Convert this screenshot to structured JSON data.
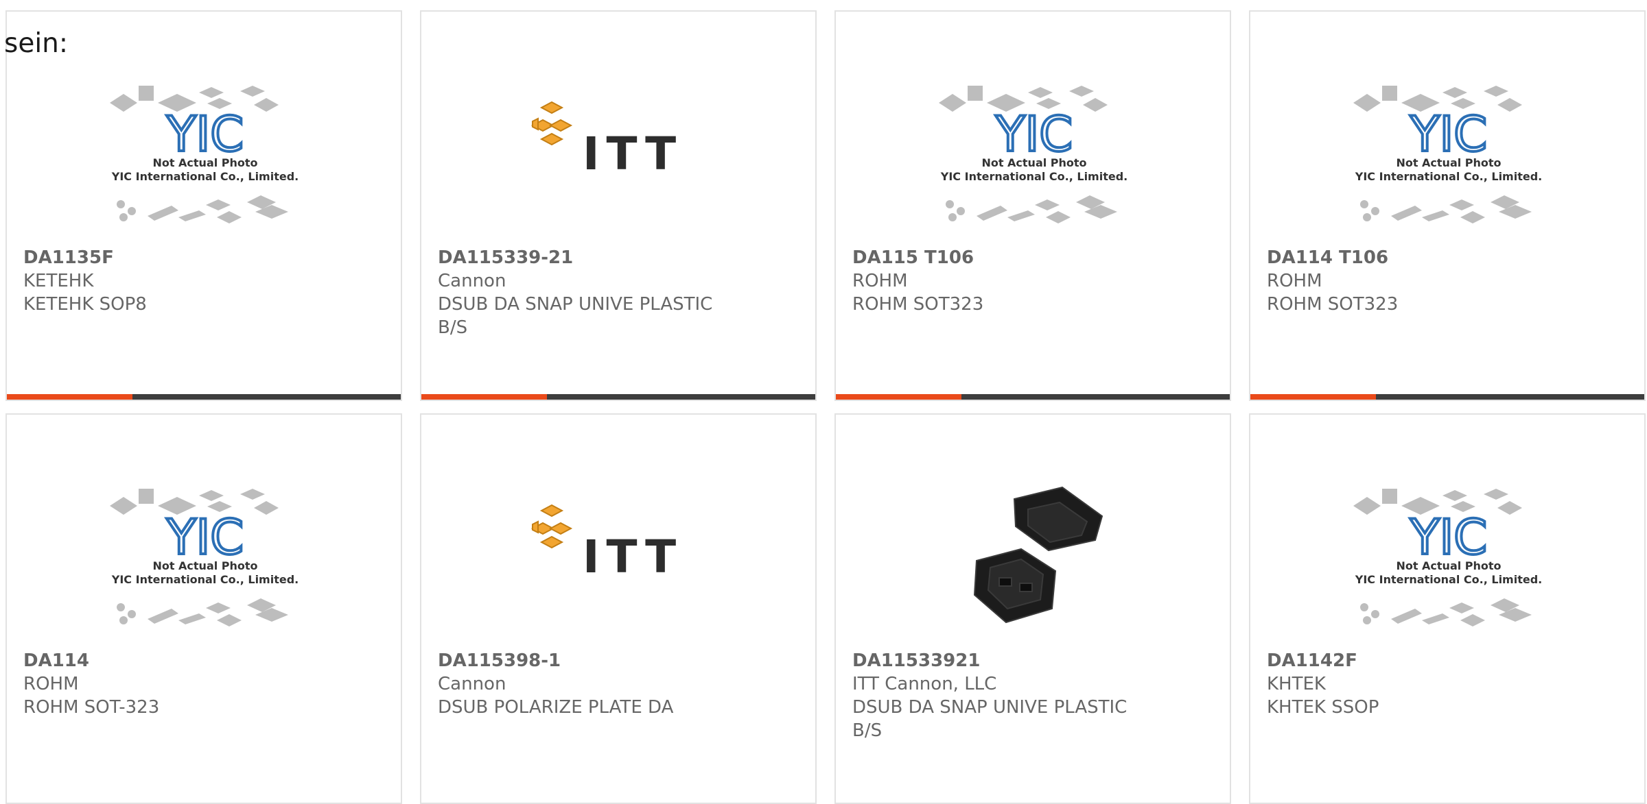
{
  "lead_text": "sein:",
  "colors": {
    "accent": "#ea4a1a",
    "bar_dark": "#3e3e3e",
    "yic_blue": "#2b6fb5",
    "itt_orange": "#f2a531"
  },
  "products": [
    {
      "part_number": "DA1135F",
      "manufacturer": "KETEHK",
      "description": "KETEHK SOP8",
      "image": "yic-placeholder",
      "image_caption": "Not Actual Photo",
      "image_caption2": "YIC International Co., Limited."
    },
    {
      "part_number": "DA115339-21",
      "manufacturer": "Cannon",
      "description": "DSUB DA SNAP UNIVE PLASTIC B/S",
      "image": "itt-logo",
      "logo_text": "ITT"
    },
    {
      "part_number": "DA115 T106",
      "manufacturer": "ROHM",
      "description": "ROHM SOT323",
      "image": "yic-placeholder",
      "image_caption": "Not Actual Photo",
      "image_caption2": "YIC International Co., Limited."
    },
    {
      "part_number": "DA114 T106",
      "manufacturer": "ROHM",
      "description": "ROHM SOT323",
      "image": "yic-placeholder",
      "image_caption": "Not Actual Photo",
      "image_caption2": "YIC International Co., Limited."
    },
    {
      "part_number": "DA114",
      "manufacturer": "ROHM",
      "description": "ROHM SOT-323",
      "image": "yic-placeholder",
      "image_caption": "Not Actual Photo",
      "image_caption2": "YIC International Co., Limited."
    },
    {
      "part_number": "DA115398-1",
      "manufacturer": "Cannon",
      "description": "DSUB POLARIZE PLATE DA",
      "image": "itt-logo",
      "logo_text": "ITT"
    },
    {
      "part_number": "DA11533921",
      "manufacturer": "ITT Cannon, LLC",
      "description": "DSUB DA SNAP UNIVE PLASTIC B/S",
      "image": "connector-photo"
    },
    {
      "part_number": "DA1142F",
      "manufacturer": "KHTEK",
      "description": "KHTEK SSOP",
      "image": "yic-placeholder",
      "image_caption": "Not Actual Photo",
      "image_caption2": "YIC International Co., Limited."
    }
  ]
}
